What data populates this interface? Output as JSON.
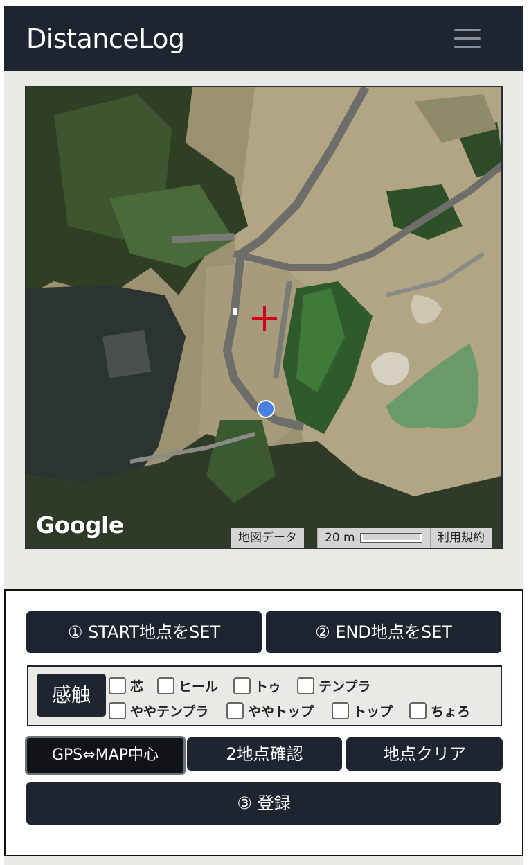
{
  "navbar": {
    "brand": "DistanceLog",
    "menu_icon": "hamburger-menu-icon"
  },
  "map": {
    "provider_logo": "Google",
    "attribution_data": "地図データ",
    "scale_label": "20 m",
    "terms": "利用規約",
    "center_marker_icon": "red-crosshair-icon",
    "location_marker_icon": "blue-dot-location-icon"
  },
  "controls": {
    "start_button": "① START地点をSET",
    "end_button": "② END地点をSET",
    "feel_label": "感触",
    "feel_options": [
      "芯",
      "ヒール",
      "トゥ",
      "テンプラ",
      "ややテンプラ",
      "ややトップ",
      "トップ",
      "ちょろ"
    ],
    "gps_map_button": "GPS⇔MAP中心",
    "confirm_button": "2地点確認",
    "clear_button": "地点クリア",
    "register_button": "③ 登録"
  },
  "colors": {
    "navbar_bg": "#1f2431",
    "button_bg": "#1f2431",
    "page_bg": "#e9eae6",
    "crosshair": "#d0021b",
    "location_dot": "#4a80e0"
  }
}
